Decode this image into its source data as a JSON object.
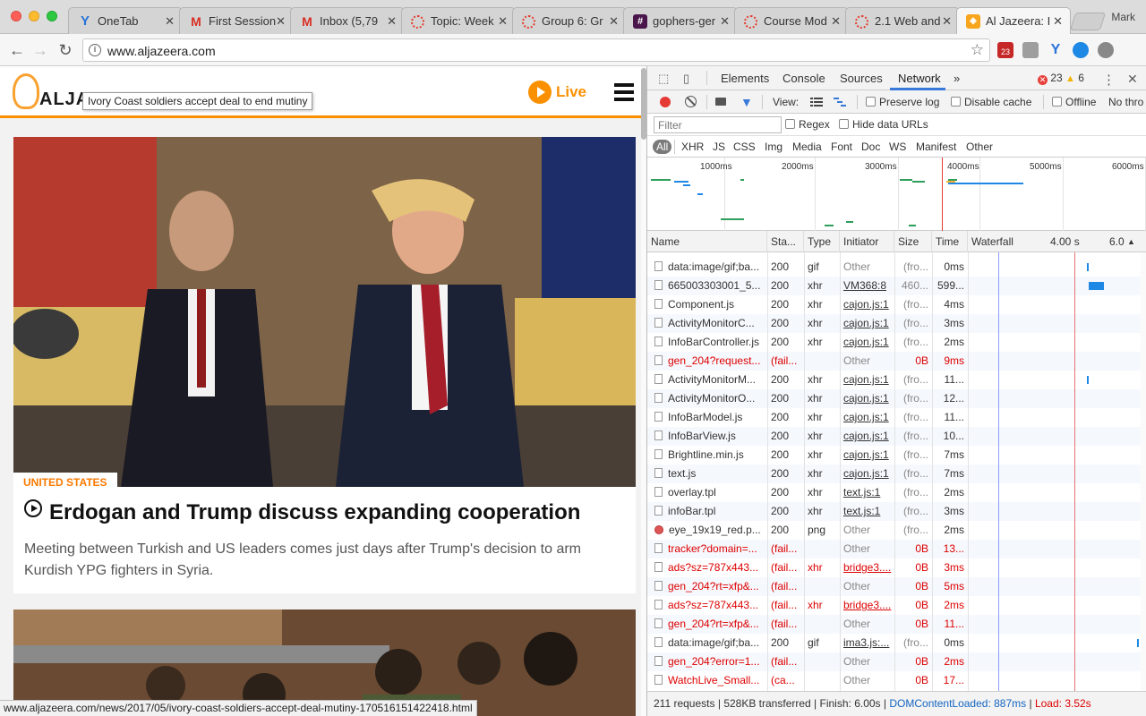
{
  "browser": {
    "tabs": [
      {
        "title": "OneTab",
        "icon": "onetab-icon"
      },
      {
        "title": "First Session",
        "icon": "gmail-icon"
      },
      {
        "title": "Inbox (5,79",
        "icon": "gmail-icon"
      },
      {
        "title": "Topic: Week",
        "icon": "loading-ring-icon"
      },
      {
        "title": "Group 6: Gr",
        "icon": "loading-ring-icon"
      },
      {
        "title": "gophers-ger",
        "icon": "slack-hash-icon"
      },
      {
        "title": "Course Mod",
        "icon": "loading-ring-icon"
      },
      {
        "title": "2.1 Web and",
        "icon": "loading-ring-icon"
      },
      {
        "title": "Al Jazeera: I",
        "icon": "aljazeera-icon"
      }
    ],
    "profile_name": "Mark",
    "url": "www.aljazeera.com",
    "calendar_badge": "23",
    "status_url": "www.aljazeera.com/news/2017/05/ivory-coast-soldiers-accept-deal-mutiny-170516151422418.html"
  },
  "site": {
    "logo_text": "ALJA",
    "tooltip": "Ivory Coast soldiers accept deal to end mutiny",
    "live_label": "Live",
    "category": "UNITED STATES",
    "headline": "Erdogan and Trump discuss expanding cooperation",
    "summary": "Meeting between Turkish and US leaders comes just days after Trump's decision to arm Kurdish YPG fighters in Syria.",
    "colors": {
      "accent": "#fa9000"
    }
  },
  "devtools": {
    "tabs": [
      "Elements",
      "Console",
      "Sources",
      "Network"
    ],
    "more": "»",
    "active_tab": "Network",
    "errors": "23",
    "warnings": "6",
    "toolbar": {
      "view_label": "View:",
      "preserve_log": "Preserve log",
      "disable_cache": "Disable cache",
      "offline": "Offline",
      "throttle": "No thro"
    },
    "filter_placeholder": "Filter",
    "regex_label": "Regex",
    "hide_data_urls": "Hide data URLs",
    "type_filters": [
      "All",
      "XHR",
      "JS",
      "CSS",
      "Img",
      "Media",
      "Font",
      "Doc",
      "WS",
      "Manifest",
      "Other"
    ],
    "overview_ticks": [
      "1000ms",
      "2000ms",
      "3000ms",
      "4000ms",
      "5000ms",
      "6000ms"
    ],
    "columns": {
      "name": "Name",
      "status": "Sta...",
      "type": "Type",
      "initiator": "Initiator",
      "size": "Size",
      "time": "Time",
      "waterfall": "Waterfall",
      "wf_tick1": "4.00 s",
      "wf_tick2": "6.0"
    },
    "requests": [
      {
        "name": "data:image/gif;ba...",
        "status": "200",
        "type": "gif",
        "initiator": "Other",
        "size": "(fro...",
        "time": "0ms",
        "fail": false,
        "link": false,
        "wf": 0.69,
        "wfw": 0.01
      },
      {
        "name": "665003303001_5...",
        "status": "200",
        "type": "xhr",
        "initiator": "VM368:8",
        "size": "460...",
        "time": "599...",
        "fail": false,
        "link": true,
        "wf": 0.7,
        "wfw": 0.09
      },
      {
        "name": "Component.js",
        "status": "200",
        "type": "xhr",
        "initiator": "cajon.js:1",
        "size": "(fro...",
        "time": "4ms",
        "fail": false,
        "link": true,
        "wf": 0,
        "wfw": 0
      },
      {
        "name": "ActivityMonitorC...",
        "status": "200",
        "type": "xhr",
        "initiator": "cajon.js:1",
        "size": "(fro...",
        "time": "3ms",
        "fail": false,
        "link": true,
        "wf": 0,
        "wfw": 0
      },
      {
        "name": "InfoBarController.js",
        "status": "200",
        "type": "xhr",
        "initiator": "cajon.js:1",
        "size": "(fro...",
        "time": "2ms",
        "fail": false,
        "link": true,
        "wf": 0,
        "wfw": 0
      },
      {
        "name": "gen_204?request...",
        "status": "(fail...",
        "type": "",
        "initiator": "Other",
        "size": "0B",
        "time": "9ms",
        "fail": true,
        "link": false,
        "wf": 0,
        "wfw": 0
      },
      {
        "name": "ActivityMonitorM...",
        "status": "200",
        "type": "xhr",
        "initiator": "cajon.js:1",
        "size": "(fro...",
        "time": "11...",
        "fail": false,
        "link": true,
        "wf": 0.69,
        "wfw": 0.01
      },
      {
        "name": "ActivityMonitorO...",
        "status": "200",
        "type": "xhr",
        "initiator": "cajon.js:1",
        "size": "(fro...",
        "time": "12...",
        "fail": false,
        "link": true,
        "wf": 0,
        "wfw": 0
      },
      {
        "name": "InfoBarModel.js",
        "status": "200",
        "type": "xhr",
        "initiator": "cajon.js:1",
        "size": "(fro...",
        "time": "11...",
        "fail": false,
        "link": true,
        "wf": 0,
        "wfw": 0
      },
      {
        "name": "InfoBarView.js",
        "status": "200",
        "type": "xhr",
        "initiator": "cajon.js:1",
        "size": "(fro...",
        "time": "10...",
        "fail": false,
        "link": true,
        "wf": 0,
        "wfw": 0
      },
      {
        "name": "Brightline.min.js",
        "status": "200",
        "type": "xhr",
        "initiator": "cajon.js:1",
        "size": "(fro...",
        "time": "7ms",
        "fail": false,
        "link": true,
        "wf": 0,
        "wfw": 0
      },
      {
        "name": "text.js",
        "status": "200",
        "type": "xhr",
        "initiator": "cajon.js:1",
        "size": "(fro...",
        "time": "7ms",
        "fail": false,
        "link": true,
        "wf": 0,
        "wfw": 0
      },
      {
        "name": "overlay.tpl",
        "status": "200",
        "type": "xhr",
        "initiator": "text.js:1",
        "size": "(fro...",
        "time": "2ms",
        "fail": false,
        "link": true,
        "wf": 0,
        "wfw": 0
      },
      {
        "name": "infoBar.tpl",
        "status": "200",
        "type": "xhr",
        "initiator": "text.js:1",
        "size": "(fro...",
        "time": "3ms",
        "fail": false,
        "link": true,
        "wf": 0,
        "wfw": 0
      },
      {
        "name": "eye_19x19_red.p...",
        "status": "200",
        "type": "png",
        "initiator": "Other",
        "size": "(fro...",
        "time": "2ms",
        "fail": false,
        "link": false,
        "img": true,
        "wf": 0,
        "wfw": 0
      },
      {
        "name": "tracker?domain=...",
        "status": "(fail...",
        "type": "",
        "initiator": "Other",
        "size": "0B",
        "time": "13...",
        "fail": true,
        "link": false,
        "wf": 0,
        "wfw": 0
      },
      {
        "name": "ads?sz=787x443...",
        "status": "(fail...",
        "type": "xhr",
        "initiator": "bridge3....",
        "size": "0B",
        "time": "3ms",
        "fail": true,
        "link": true,
        "wf": 0,
        "wfw": 0
      },
      {
        "name": "gen_204?rt=xfp&...",
        "status": "(fail...",
        "type": "",
        "initiator": "Other",
        "size": "0B",
        "time": "5ms",
        "fail": true,
        "link": false,
        "wf": 0,
        "wfw": 0
      },
      {
        "name": "ads?sz=787x443...",
        "status": "(fail...",
        "type": "xhr",
        "initiator": "bridge3....",
        "size": "0B",
        "time": "2ms",
        "fail": true,
        "link": true,
        "wf": 0,
        "wfw": 0
      },
      {
        "name": "gen_204?rt=xfp&...",
        "status": "(fail...",
        "type": "",
        "initiator": "Other",
        "size": "0B",
        "time": "11...",
        "fail": true,
        "link": false,
        "wf": 0,
        "wfw": 0
      },
      {
        "name": "data:image/gif;ba...",
        "status": "200",
        "type": "gif",
        "initiator": "ima3.js:...",
        "size": "(fro...",
        "time": "0ms",
        "fail": false,
        "link": true,
        "wf": 0.98,
        "wfw": 0.01
      },
      {
        "name": "gen_204?error=1...",
        "status": "(fail...",
        "type": "",
        "initiator": "Other",
        "size": "0B",
        "time": "2ms",
        "fail": true,
        "link": false,
        "wf": 0,
        "wfw": 0
      },
      {
        "name": "WatchLive_Small...",
        "status": "(ca...",
        "type": "",
        "initiator": "Other",
        "size": "0B",
        "time": "17...",
        "fail": true,
        "link": false,
        "wf": 0,
        "wfw": 0
      }
    ],
    "summary": {
      "requests": "211 requests",
      "transferred": "528KB transferred",
      "finish": "Finish: 6.00s",
      "dcl": "DOMContentLoaded: 887ms",
      "load": "Load: 3.52s",
      "divider": "|"
    },
    "colors": {
      "error": "#d00000",
      "link_blue": "#1565c0",
      "dcl_line": "#3b5bdb",
      "load_line": "#e53935",
      "bar": "#1e88e5"
    }
  }
}
